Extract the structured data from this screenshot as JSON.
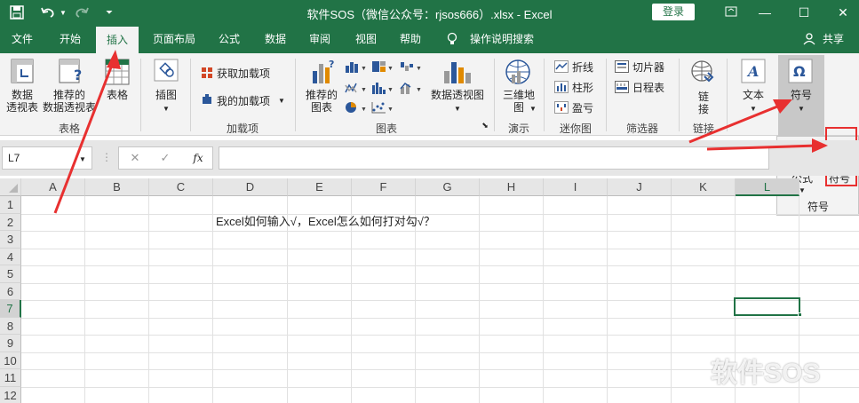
{
  "titlebar": {
    "title": "软件SOS（微信公众号：rjsos666）.xlsx  -  Excel",
    "login": "登录",
    "save_icon": "save-icon",
    "undo_icon": "undo-icon",
    "redo_icon": "redo-icon",
    "customize_icon": "customize-icon"
  },
  "menu": {
    "file": "文件",
    "home": "开始",
    "insert": "插入",
    "page_layout": "页面布局",
    "formulas": "公式",
    "data": "数据",
    "review": "审阅",
    "view": "视图",
    "help": "帮助",
    "tell_me": "操作说明搜索",
    "share": "共享"
  },
  "ribbon": {
    "pivot_table": [
      "数据",
      "透视表"
    ],
    "recommended_pivot": [
      "推荐的",
      "数据透视表"
    ],
    "table": "表格",
    "group_tables": "表格",
    "illustrations": "插图",
    "get_addins": "获取加载项",
    "my_addins": "我的加载项",
    "group_addins": "加载项",
    "recommended_charts": [
      "推荐的",
      "图表"
    ],
    "pivot_chart": "数据透视图",
    "group_charts": "图表",
    "map_3d": [
      "三维地",
      "图"
    ],
    "group_tours": "演示",
    "spark_line": "折线",
    "spark_column": "柱形",
    "spark_winloss": "盈亏",
    "group_sparklines": "迷你图",
    "slicer": "切片器",
    "timeline": "日程表",
    "group_filters": "筛选器",
    "link": [
      "链",
      "接"
    ],
    "group_links": "链接",
    "text": "文本",
    "symbols": "符号"
  },
  "formula_bar": {
    "name_box": "L7",
    "fx": "fx",
    "formula": ""
  },
  "grid": {
    "columns": [
      "A",
      "B",
      "C",
      "D",
      "E",
      "F",
      "G",
      "H",
      "I",
      "J",
      "K",
      "L"
    ],
    "rows": [
      "1",
      "2",
      "3",
      "4",
      "5",
      "6",
      "7",
      "8",
      "9",
      "10",
      "11",
      "12"
    ],
    "cell_d2": "Excel如何输入√，Excel怎么如何打对勾√？"
  },
  "popup": {
    "equation": "公式",
    "symbol": "符号",
    "group_label": "符号"
  },
  "watermark": "软件SOS",
  "colors": {
    "excel_green": "#217346",
    "ribbon_bg": "#f3f3f3",
    "highlight_red": "#e83030",
    "symbol_blue": "#2b579a"
  }
}
